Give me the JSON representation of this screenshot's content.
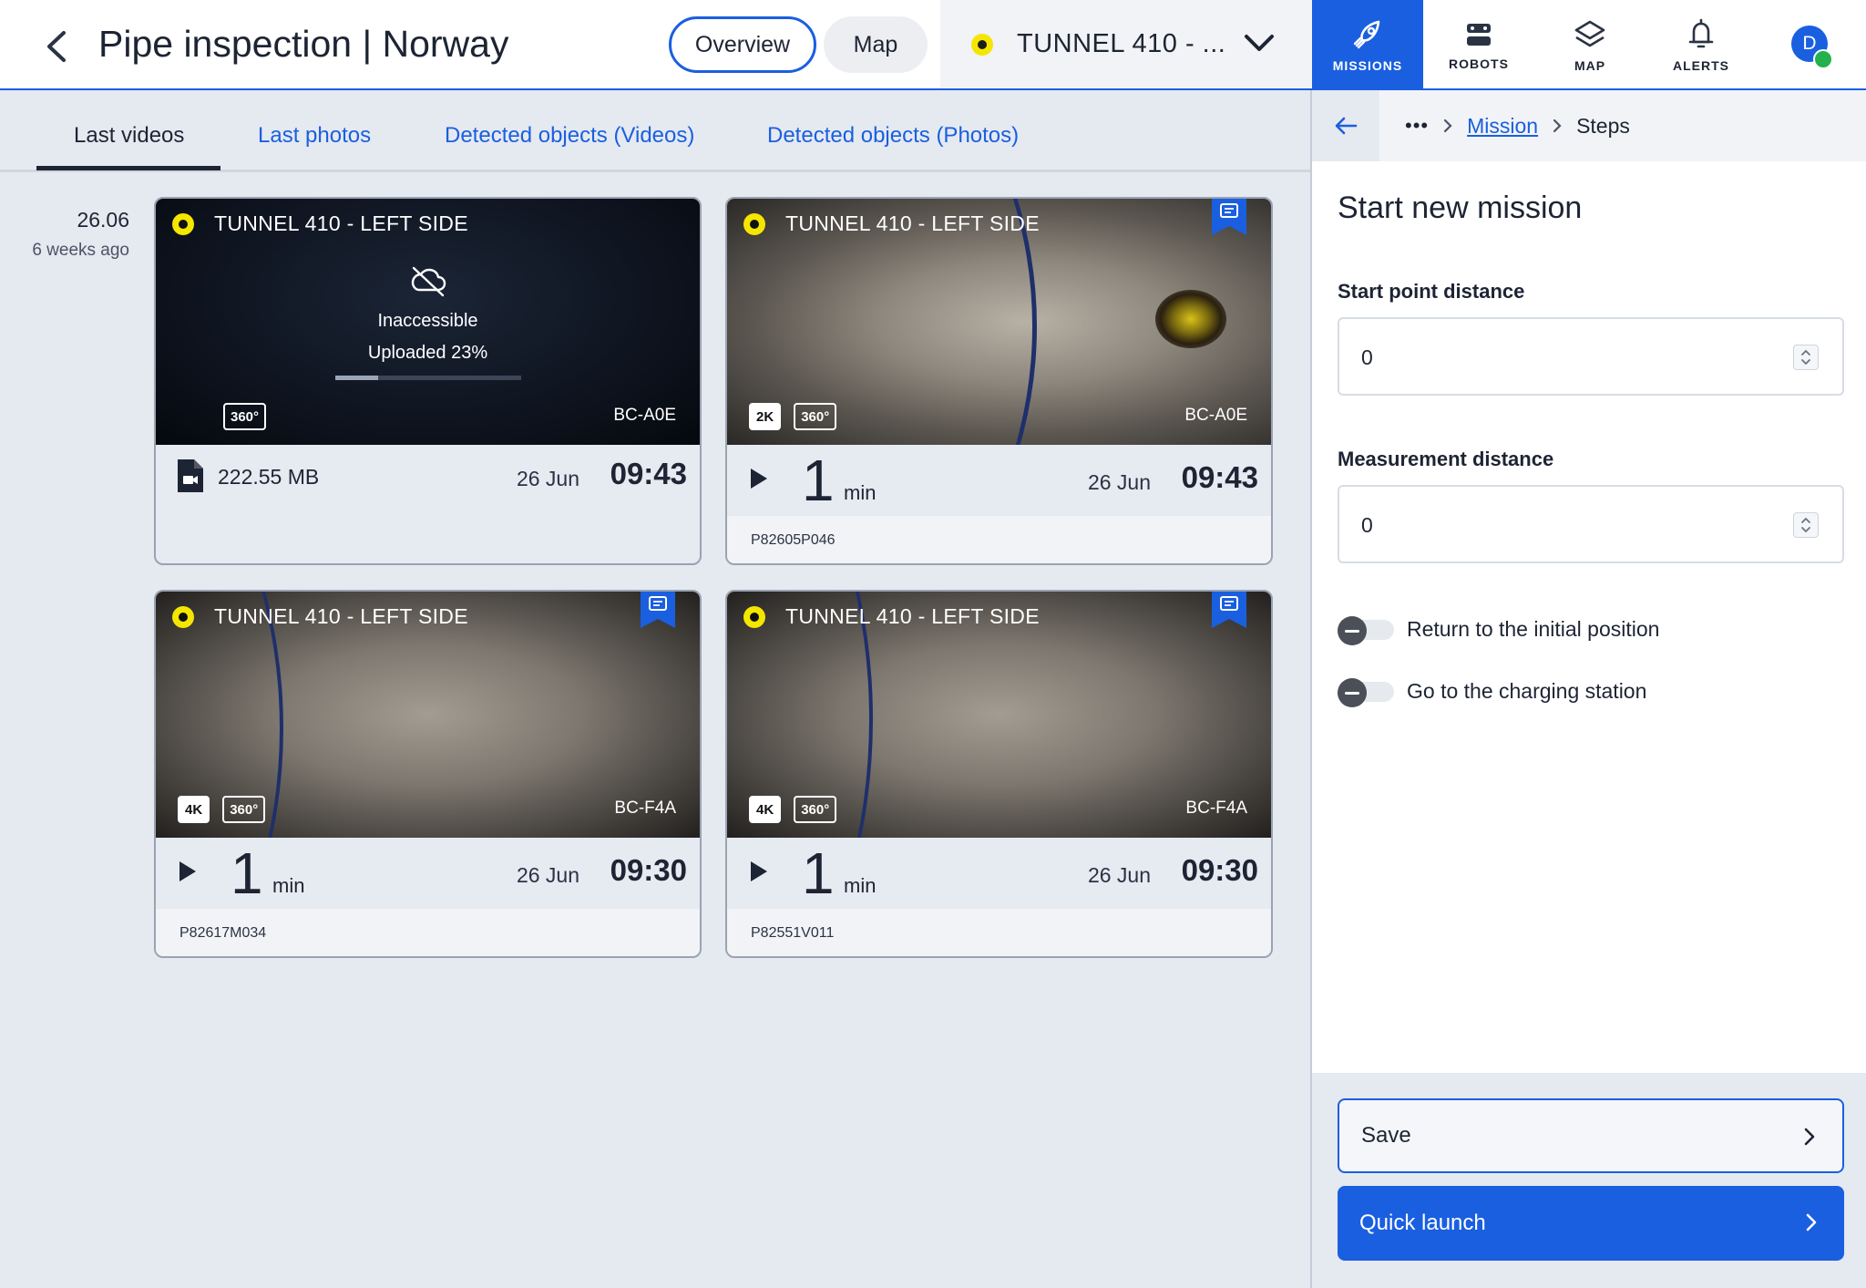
{
  "header": {
    "title": "Pipe inspection | Norway",
    "view_toggle": {
      "overview": "Overview",
      "map": "Map"
    },
    "tunnel_select": "TUNNEL 410 - ...",
    "nav": [
      {
        "label": "MISSIONS",
        "icon": "rocket-icon",
        "active": true
      },
      {
        "label": "ROBOTS",
        "icon": "robot-icon",
        "active": false
      },
      {
        "label": "MAP",
        "icon": "layers-icon",
        "active": false
      },
      {
        "label": "ALERTS",
        "icon": "bell-icon",
        "active": false
      }
    ],
    "avatar_initial": "D",
    "accent_color": "#1a5fe0",
    "status_color": "#f5e600"
  },
  "tabs": [
    {
      "label": "Last videos",
      "active": true
    },
    {
      "label": "Last photos"
    },
    {
      "label": "Detected objects (Videos)"
    },
    {
      "label": "Detected objects (Photos)"
    }
  ],
  "date_group": {
    "day": "26.06",
    "ago": "6 weeks ago"
  },
  "cards": [
    {
      "title": "TUNNEL 410 - LEFT SIDE",
      "state": "inaccessible",
      "inaccessible_label": "Inaccessible",
      "upload_label": "Uploaded 23%",
      "upload_progress": 0.23,
      "badges": [
        "360°"
      ],
      "robot": "BC-A0E",
      "file_size": "222.55 MB",
      "date": "26 Jun",
      "time": "09:43"
    },
    {
      "title": "TUNNEL 410 - LEFT SIDE",
      "bookmarked": true,
      "badges": [
        "2K",
        "360°"
      ],
      "robot": "BC-A0E",
      "duration": "1",
      "duration_unit": "min",
      "date": "26 Jun",
      "time": "09:43",
      "code": "P82605P046"
    },
    {
      "title": "TUNNEL 410 - LEFT SIDE",
      "bookmarked": true,
      "badges": [
        "4K",
        "360°"
      ],
      "robot": "BC-F4A",
      "duration": "1",
      "duration_unit": "min",
      "date": "26 Jun",
      "time": "09:30",
      "code": "P82617M034"
    },
    {
      "title": "TUNNEL 410 - LEFT SIDE",
      "bookmarked": true,
      "badges": [
        "4K",
        "360°"
      ],
      "robot": "BC-F4A",
      "duration": "1",
      "duration_unit": "min",
      "date": "26 Jun",
      "time": "09:30",
      "code": "P82551V011"
    }
  ],
  "panel": {
    "breadcrumb": {
      "more": "•••",
      "link": "Mission",
      "current": "Steps"
    },
    "title": "Start new mission",
    "start_point_label": "Start point distance",
    "start_point_value": "0",
    "measurement_label": "Measurement distance",
    "measurement_value": "0",
    "toggle_return": "Return to the initial position",
    "toggle_charging": "Go to the charging station",
    "save_label": "Save",
    "quick_launch_label": "Quick launch"
  }
}
